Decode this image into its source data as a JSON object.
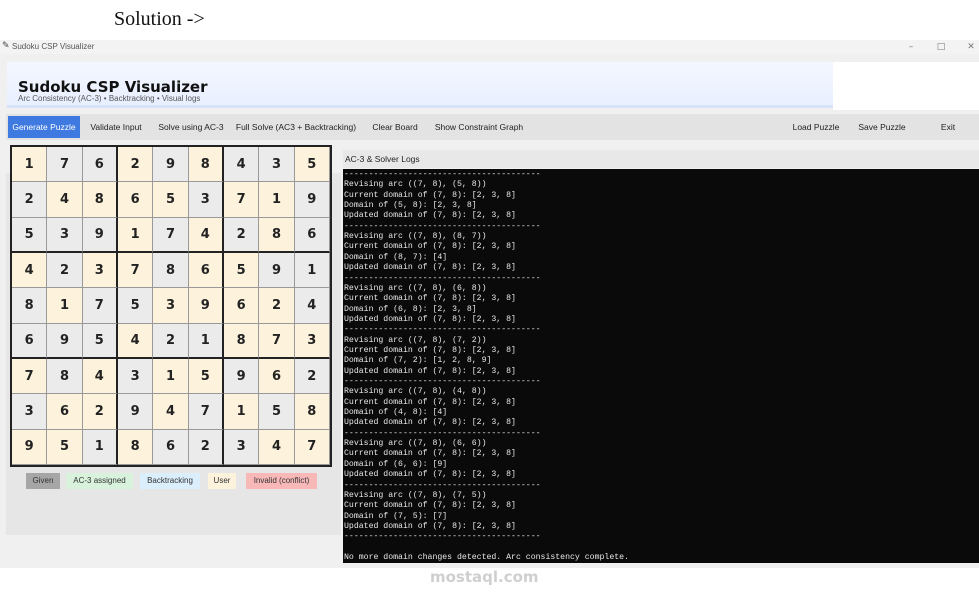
{
  "caption": "Solution ->",
  "window": {
    "title": "Sudoku CSP Visualizer",
    "controls": {
      "minimize": "–",
      "maximize": "□",
      "close": "✕"
    }
  },
  "header": {
    "title": "Sudoku CSP Visualizer",
    "subtitle": "Arc Consistency (AC-3) • Backtracking • Visual logs"
  },
  "toolbar": {
    "generate": "Generate Puzzle",
    "validate": "Validate Input",
    "solve_ac3": "Solve using AC-3",
    "full_solve": "Full Solve (AC3 + Backtracking)",
    "clear": "Clear Board",
    "show_graph": "Show Constraint Graph",
    "load": "Load Puzzle",
    "save": "Save Puzzle",
    "exit": "Exit"
  },
  "board": {
    "values": [
      [
        1,
        7,
        6,
        2,
        9,
        8,
        4,
        3,
        5
      ],
      [
        2,
        4,
        8,
        6,
        5,
        3,
        7,
        1,
        9
      ],
      [
        5,
        3,
        9,
        1,
        7,
        4,
        2,
        8,
        6
      ],
      [
        4,
        2,
        3,
        7,
        8,
        6,
        5,
        9,
        1
      ],
      [
        8,
        1,
        7,
        5,
        3,
        9,
        6,
        2,
        4
      ],
      [
        6,
        9,
        5,
        4,
        2,
        1,
        8,
        7,
        3
      ],
      [
        7,
        8,
        4,
        3,
        1,
        5,
        9,
        6,
        2
      ],
      [
        3,
        6,
        2,
        9,
        4,
        7,
        1,
        5,
        8
      ],
      [
        9,
        5,
        1,
        8,
        6,
        2,
        3,
        4,
        7
      ]
    ],
    "given": [
      [
        0,
        1,
        1,
        0,
        1,
        0,
        1,
        1,
        0
      ],
      [
        1,
        0,
        0,
        0,
        0,
        1,
        0,
        0,
        1
      ],
      [
        1,
        1,
        1,
        0,
        1,
        0,
        1,
        0,
        1
      ],
      [
        0,
        1,
        0,
        0,
        1,
        0,
        0,
        1,
        1
      ],
      [
        1,
        0,
        1,
        1,
        0,
        0,
        0,
        0,
        1
      ],
      [
        1,
        1,
        1,
        0,
        1,
        1,
        0,
        0,
        0
      ],
      [
        0,
        1,
        0,
        1,
        0,
        0,
        1,
        0,
        1
      ],
      [
        1,
        0,
        0,
        1,
        0,
        1,
        0,
        1,
        0
      ],
      [
        0,
        0,
        1,
        0,
        1,
        1,
        1,
        0,
        0
      ]
    ]
  },
  "legend": [
    {
      "label": "Given",
      "color": "#a6a6a6"
    },
    {
      "label": "AC-3 assigned",
      "color": "#d9f2dc"
    },
    {
      "label": "Backtracking",
      "color": "#dbeefc"
    },
    {
      "label": "User",
      "color": "#fdf3dc"
    },
    {
      "label": "Invalid (conflict)",
      "color": "#f8b8b8"
    }
  ],
  "log": {
    "title": "AC-3 & Solver Logs",
    "lines": [
      "----------------------------------------",
      "Revising arc ((7, 8), (5, 8))",
      "Current domain of (7, 8): [2, 3, 8]",
      "Domain of (5, 8): [2, 3, 8]",
      "Updated domain of (7, 8): [2, 3, 8]",
      "----------------------------------------",
      "Revising arc ((7, 8), (8, 7))",
      "Current domain of (7, 8): [2, 3, 8]",
      "Domain of (8, 7): [4]",
      "Updated domain of (7, 8): [2, 3, 8]",
      "----------------------------------------",
      "Revising arc ((7, 8), (6, 8))",
      "Current domain of (7, 8): [2, 3, 8]",
      "Domain of (6, 8): [2, 3, 8]",
      "Updated domain of (7, 8): [2, 3, 8]",
      "----------------------------------------",
      "Revising arc ((7, 8), (7, 2))",
      "Current domain of (7, 8): [2, 3, 8]",
      "Domain of (7, 2): [1, 2, 8, 9]",
      "Updated domain of (7, 8): [2, 3, 8]",
      "----------------------------------------",
      "Revising arc ((7, 8), (4, 8))",
      "Current domain of (7, 8): [2, 3, 8]",
      "Domain of (4, 8): [4]",
      "Updated domain of (7, 8): [2, 3, 8]",
      "----------------------------------------",
      "Revising arc ((7, 8), (6, 6))",
      "Current domain of (7, 8): [2, 3, 8]",
      "Domain of (6, 6): [9]",
      "Updated domain of (7, 8): [2, 3, 8]",
      "----------------------------------------",
      "Revising arc ((7, 8), (7, 5))",
      "Current domain of (7, 8): [2, 3, 8]",
      "Domain of (7, 5): [7]",
      "Updated domain of (7, 8): [2, 3, 8]",
      "----------------------------------------",
      "",
      "No more domain changes detected. Arc consistency complete."
    ]
  },
  "watermark": "mostaql.com"
}
